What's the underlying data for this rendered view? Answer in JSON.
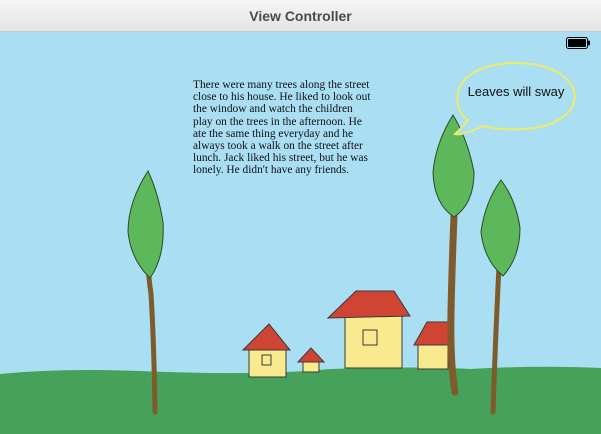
{
  "window": {
    "title": "View Controller"
  },
  "status": {
    "battery_level": 1.0
  },
  "story": {
    "text": "There were many trees along the street\nclose to his house. He liked to look out\nthe window and watch the children\nplay on the trees in the afternoon. He\nate the same thing everyday and he\nalways took a walk on the street after\nlunch. Jack liked his street, but he was\nlonely. He didn't have any friends."
  },
  "speech_bubble": {
    "text": "Leaves will sway"
  },
  "colors": {
    "sky": "#a9def3",
    "grass": "#46a15a",
    "leaf": "#5cb85a",
    "trunk": "#7f5b2c",
    "roof": "#cf4432",
    "house_wall": "#f9ea8f",
    "bubble_outline": "#ecec6a"
  }
}
